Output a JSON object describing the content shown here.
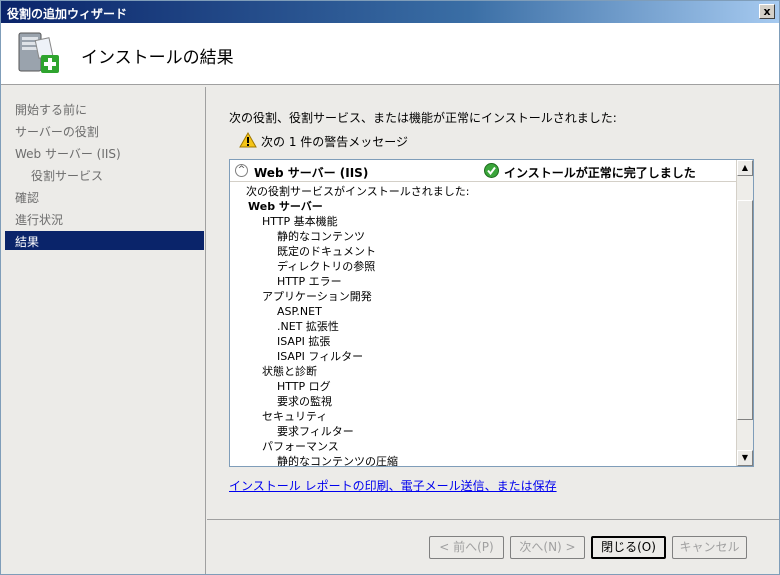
{
  "window": {
    "title": "役割の追加ウィザード",
    "close_glyph": "x"
  },
  "header": {
    "heading": "インストールの結果",
    "icon": "server-add-icon"
  },
  "sidebar": {
    "items": [
      {
        "label": "開始する前に",
        "state": "normal"
      },
      {
        "label": "サーバーの役割",
        "state": "normal"
      },
      {
        "label": "Web サーバー (IIS)",
        "state": "normal"
      },
      {
        "label": "役割サービス",
        "state": "sub"
      },
      {
        "label": "確認",
        "state": "normal"
      },
      {
        "label": "進行状況",
        "state": "normal"
      },
      {
        "label": "結果",
        "state": "active"
      }
    ]
  },
  "main": {
    "intro": "次の役割、役割サービス、または機能が正常にインストールされました:",
    "warning": "次の 1 件の警告メッセージ",
    "result": {
      "title": "Web サーバー (IIS)",
      "status": "インストールが正常に完了しました",
      "tree": [
        {
          "text": "次の役割サービスがインストールされました:",
          "level": 0
        },
        {
          "text": "Web サーバー",
          "level": 1
        },
        {
          "text": "HTTP 基本機能",
          "level": 2
        },
        {
          "text": "静的なコンテンツ",
          "level": 3
        },
        {
          "text": "既定のドキュメント",
          "level": 3
        },
        {
          "text": "ディレクトリの参照",
          "level": 3
        },
        {
          "text": "HTTP エラー",
          "level": 3
        },
        {
          "text": "アプリケーション開発",
          "level": 2
        },
        {
          "text": "ASP.NET",
          "level": 3
        },
        {
          "text": ".NET 拡張性",
          "level": 3
        },
        {
          "text": "ISAPI 拡張",
          "level": 3
        },
        {
          "text": "ISAPI フィルター",
          "level": 3
        },
        {
          "text": "状態と診断",
          "level": 2
        },
        {
          "text": "HTTP ログ",
          "level": 3
        },
        {
          "text": "要求の監視",
          "level": 3
        },
        {
          "text": "セキュリティ",
          "level": 2
        },
        {
          "text": "要求フィルター",
          "level": 3
        },
        {
          "text": "パフォーマンス",
          "level": 2
        },
        {
          "text": "静的なコンテンツの圧縮",
          "level": 3
        }
      ]
    },
    "report_link": "インストール レポートの印刷、電子メール送信、または保存"
  },
  "footer": {
    "prev": "< 前へ(P)",
    "next": "次へ(N) >",
    "close": "閉じる(O)",
    "cancel": "キャンセル"
  },
  "colors": {
    "active_bg": "#0a246a",
    "link": "#0000ee",
    "disabled_text": "#a0a0a0"
  }
}
